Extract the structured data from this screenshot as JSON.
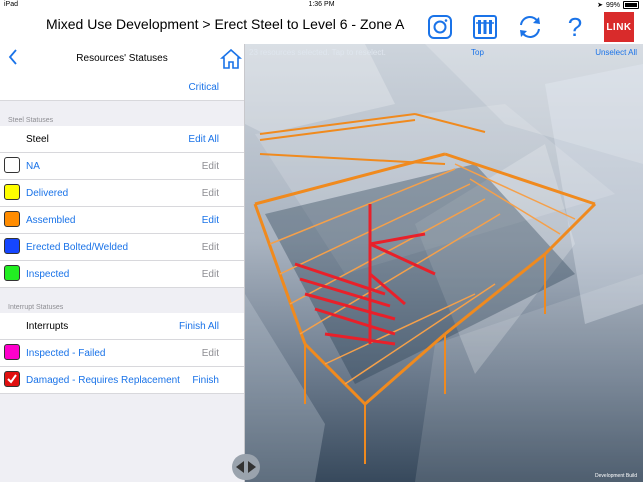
{
  "status_bar": {
    "device": "iPad",
    "time": "1:36 PM",
    "battery": "99%"
  },
  "header": {
    "title": "Mixed Use Development > Erect Steel to Level 6 - Zone A",
    "logo_text": "LINK"
  },
  "toolbar_icons": [
    "camera-icon",
    "resources-icon",
    "sync-icon",
    "help-icon",
    "link-logo"
  ],
  "panel": {
    "title": "Resources' Statuses",
    "critical_label": "Critical",
    "steel_section_label": "Steel Statuses",
    "steel_group": {
      "label": "Steel",
      "action": "Edit All"
    },
    "steel_items": [
      {
        "label": "NA",
        "action": "Edit",
        "color": "#ffffff"
      },
      {
        "label": "Delivered",
        "action": "Edit",
        "color": "#ffff00"
      },
      {
        "label": "Assembled",
        "action": "Edit",
        "color": "#ff8c00"
      },
      {
        "label": "Erected Bolted/Welded",
        "action": "Edit",
        "color": "#1546ff"
      },
      {
        "label": "Inspected",
        "action": "Edit",
        "color": "#22ee22"
      }
    ],
    "interrupt_section_label": "Interrupt Statuses",
    "interrupt_group": {
      "label": "Interrupts",
      "action": "Finish All"
    },
    "interrupt_items": [
      {
        "label": "Inspected - Failed",
        "action": "Edit",
        "color": "#ff00cc"
      },
      {
        "label": "Damaged - Requires Replacement",
        "action": "Finish",
        "color": "#e01010",
        "checked": true
      }
    ]
  },
  "viewer": {
    "selection_text": "23 resources selected. Tap to reselect.",
    "top_label": "Top",
    "unselect_label": "Unselect All",
    "build_label": "Development Build"
  },
  "colors": {
    "accent": "#1a73e8",
    "steel_orange": "#f08a1e",
    "highlight_red": "#e8202a"
  }
}
